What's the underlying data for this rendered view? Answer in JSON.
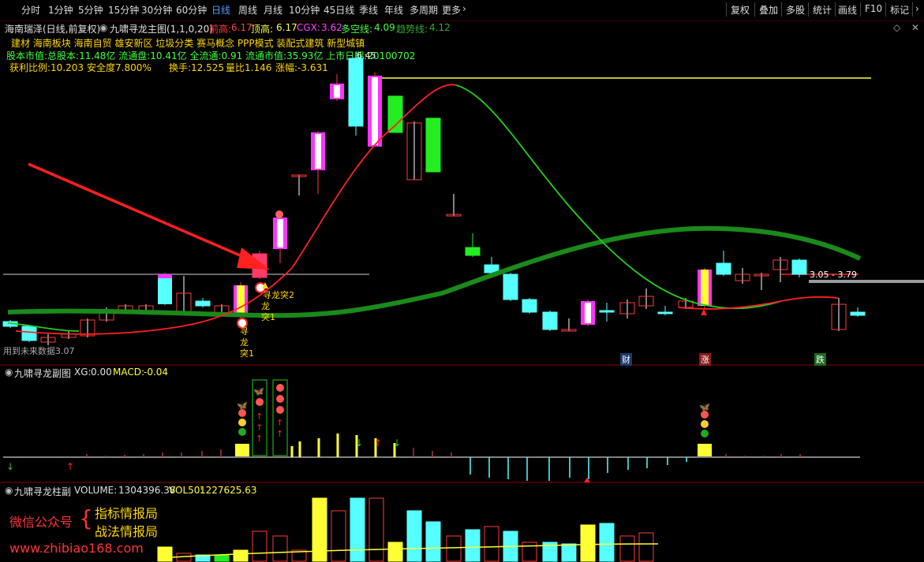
{
  "toolbar": {
    "tabs": [
      "分时",
      "1分钟",
      "5分钟",
      "15分钟",
      "30分钟",
      "60分钟",
      "日线",
      "周线",
      "月线",
      "10分钟",
      "45日线",
      "季线",
      "年线",
      "多周期",
      "更多"
    ],
    "active_tab": "日线",
    "right_buttons": [
      "复权",
      "叠加",
      "多股",
      "统计",
      "画线",
      "F10",
      "标记"
    ]
  },
  "header": {
    "stock": "海南瑞泽(日线,前复权)",
    "indicator": "九啸寻龙主图(1,1,0,20)",
    "pre_high_label": "前高:",
    "pre_high_value": "6.17",
    "top_high_label": "顶高:",
    "top_high_value": "6.17",
    "cgx_label": "CGX:",
    "cgx_value": "3.62",
    "multi_empty_label": "多空线:",
    "multi_empty_value": "4.09",
    "trend_label": "趋势线:",
    "trend_value": "4.12"
  },
  "info": {
    "line1": "建材    海南板块    海南自贸 雄安新区 垃圾分类 赛马概念 PPP模式 装配式建筑 新型城镇",
    "line2": "股本市值:总股本:11.48亿 流通盘:10.41亿 全流通:0.91 流通市值:35.93亿 上市日期:20100702",
    "profit_ratio": "获利比例:10.203",
    "safety": "安全度7.800%",
    "turnover": "换手:12.525",
    "volume_ratio": "量比1.146",
    "change": "涨幅:-3.631"
  },
  "annotations": {
    "peak": "6.45",
    "future": "用到未来数据3.07",
    "signal_a": "寻龙突2",
    "signal_b_1": "龙",
    "signal_b_2": "突1",
    "signal_c_1": "寻",
    "signal_c_2": "龙",
    "signal_c_3": "突1",
    "price_range": "3.05 - 3.79",
    "badge_cai": "财",
    "badge_zhang": "涨",
    "badge_die": "跌"
  },
  "sub1": {
    "name": "九啸寻龙副图",
    "xg_label": "XG:",
    "xg_value": "0.00",
    "macd_label": "MACD:",
    "macd_value": "-0.04"
  },
  "sub2": {
    "name": "九啸寻龙柱副",
    "volume_label": "VOLUME:",
    "volume_value": "1304396.38",
    "vol50_label": "VOL50:",
    "vol50_value": "1227625.63"
  },
  "watermark": {
    "wechat": "微信公众号",
    "item1": "指标情报局",
    "item2": "战法情报局",
    "url": "www.zhibiao168.com"
  },
  "colors": {
    "up": "#ff3a3a",
    "down": "#55ffff",
    "magenta": "#ff33ff",
    "yellow": "#ffff33",
    "green_bar": "#22ee22",
    "ma_red": "#ff2020",
    "ma_green": "#22cc22",
    "trend": "#1a8a1a"
  }
}
